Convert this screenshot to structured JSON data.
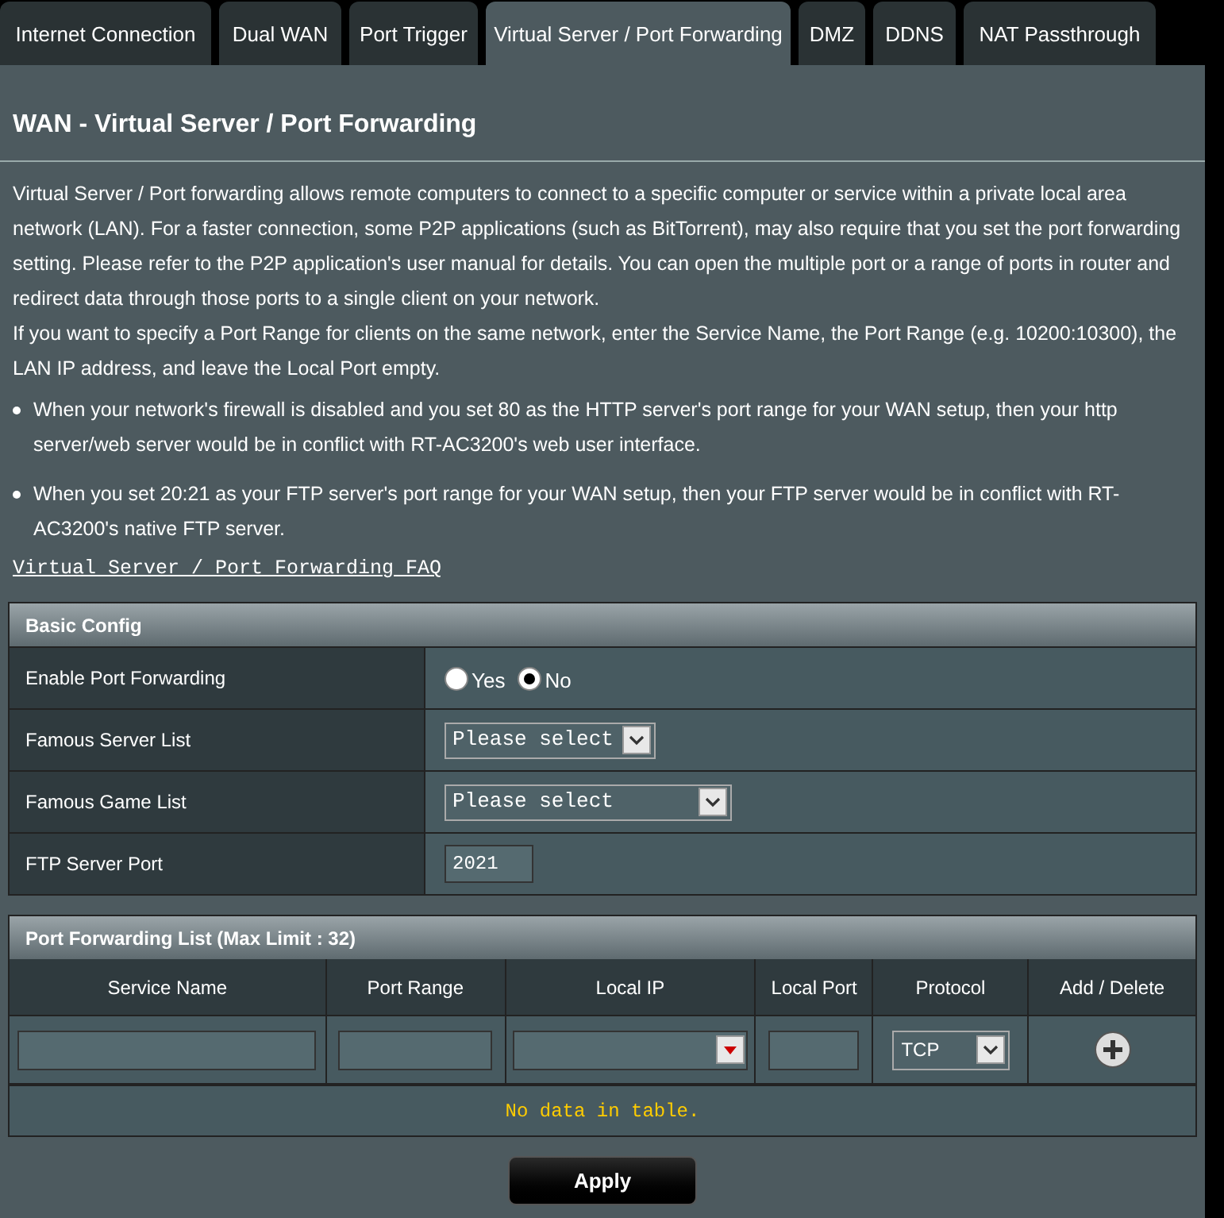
{
  "tabs": [
    {
      "label": "Internet Connection",
      "selected": false
    },
    {
      "label": "Dual WAN",
      "selected": false
    },
    {
      "label": "Port Trigger",
      "selected": false
    },
    {
      "label": "Virtual Server / Port Forwarding",
      "selected": true
    },
    {
      "label": "DMZ",
      "selected": false
    },
    {
      "label": "DDNS",
      "selected": false
    },
    {
      "label": "NAT Passthrough",
      "selected": false
    }
  ],
  "page_title": "WAN - Virtual Server / Port Forwarding",
  "description": [
    "Virtual Server / Port forwarding allows remote computers to connect to a specific computer or service within a private local area network (LAN). For a faster connection, some P2P applications (such as BitTorrent), may also require that you set the port forwarding setting. Please refer to the P2P application's user manual for details. You can open the multiple port or a range of ports in router and redirect data through those ports to a single client on your network.",
    "If you want to specify a Port Range for clients on the same network, enter the Service Name, the Port Range (e.g. 10200:10300), the LAN IP address, and leave the Local Port empty."
  ],
  "notes": [
    "When your network's firewall is disabled and you set 80 as the HTTP server's port range for your WAN setup, then your http server/web server would be in conflict with RT-AC3200's web user interface.",
    "When you set 20:21 as your FTP server's port range for your WAN setup, then your FTP server would be in conflict with RT-AC3200's native FTP server."
  ],
  "faq_link": "Virtual Server / Port Forwarding FAQ",
  "basic_config": {
    "title": "Basic Config",
    "rows": [
      {
        "kind": "radio",
        "label": "Enable Port Forwarding",
        "options": [
          {
            "label": "Yes",
            "selected": false
          },
          {
            "label": "No",
            "selected": true
          }
        ]
      },
      {
        "kind": "select",
        "label": "Famous Server List",
        "value": "Please select"
      },
      {
        "kind": "select_wide",
        "label": "Famous Game List",
        "value": "Please select"
      },
      {
        "kind": "input",
        "label": "FTP Server Port",
        "value": "2021"
      }
    ]
  },
  "port_forwarding_list": {
    "title": "Port Forwarding List (Max Limit : 32)",
    "columns": [
      "Service Name",
      "Port Range",
      "Local IP",
      "Local Port",
      "Protocol",
      "Add / Delete"
    ],
    "protocol": "TCP",
    "empty_message": "No data in table."
  },
  "apply_button": "Apply"
}
